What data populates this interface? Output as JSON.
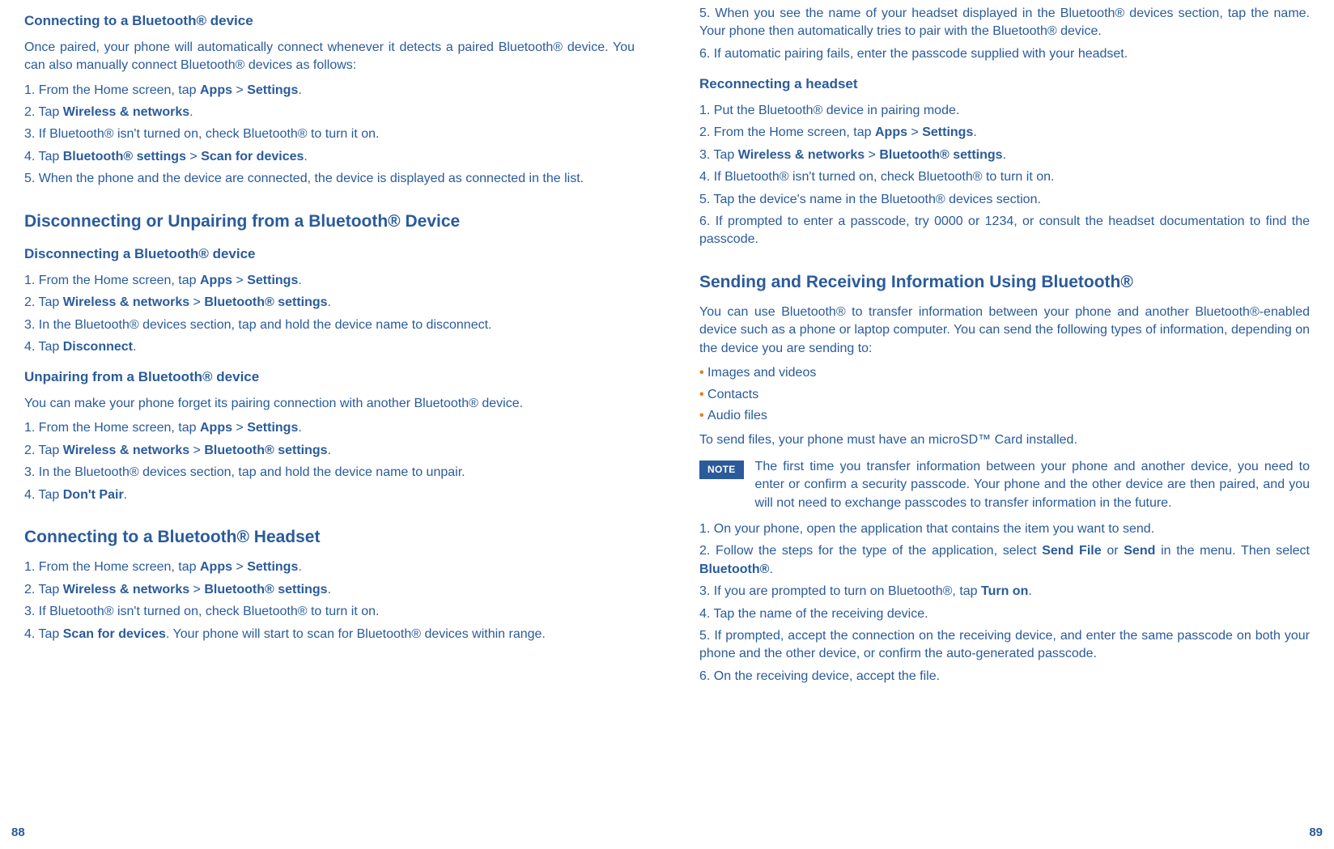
{
  "left": {
    "s1": {
      "title": "Connecting to a Bluetooth® device",
      "intro": "Once paired, your phone will automatically connect whenever it detects a paired Bluetooth® device. You can also manually connect Bluetooth® devices as follows:",
      "step1_a": "1. From the Home screen, tap ",
      "apps": "Apps",
      "gt": " > ",
      "settings": "Settings",
      "dot": ".",
      "step2_a": "2. Tap ",
      "step2_b": "Wireless & networks",
      "step3": "3. If Bluetooth® isn't turned on, check Bluetooth® to turn it on.",
      "step4_a": "4. Tap ",
      "step4_b": "Bluetooth® settings",
      "step4_c": " > ",
      "step4_d": "Scan for devices",
      "step5": "5. When the phone and the device are connected, the device is displayed as connected in the list."
    },
    "s2": {
      "title": "Disconnecting or Unpairing from a Bluetooth® Device",
      "sub1": "Disconnecting a Bluetooth® device",
      "d_step1_a": "1. From the Home screen, tap ",
      "d_step2_a": "2. Tap ",
      "d_step2_b": "Wireless & networks",
      "d_step2_c": " > ",
      "d_step2_d": "Bluetooth® settings",
      "d_step3": "3. In the Bluetooth® devices section, tap and hold the device name to disconnect.",
      "d_step4_a": "4. Tap ",
      "d_step4_b": "Disconnect",
      "sub2": "Unpairing from a Bluetooth® device",
      "u_intro": "You can make your phone forget its pairing connection with another Bluetooth® device.",
      "u_step3": "3. In the Bluetooth® devices section, tap and hold the device name to unpair.",
      "u_step4_a": "4. Tap ",
      "u_step4_b": "Don't Pair"
    },
    "s3": {
      "title": "Connecting to a Bluetooth® Headset",
      "h_step3": "3. If Bluetooth® isn't turned on, check Bluetooth® to turn it on.",
      "h_step4_a": "4. Tap ",
      "h_step4_b": "Scan for devices",
      "h_step4_c": ". Your phone will start to scan for Bluetooth® devices within range."
    },
    "page_num": "88"
  },
  "right": {
    "cont": {
      "step5": "5. When you see the name of your headset displayed in the Bluetooth® devices section, tap the name. Your phone then automatically tries to pair with the Bluetooth® device.",
      "step6": "6. If automatic pairing fails, enter the passcode supplied with your headset."
    },
    "s4": {
      "title": "Reconnecting a headset",
      "r_step1": "1. Put the Bluetooth® device in pairing mode.",
      "r_step2_a": "2. From the Home screen, tap ",
      "r_step3_a": "3. Tap ",
      "r_step4": "4. If Bluetooth® isn't turned on, check Bluetooth® to turn it on.",
      "r_step5": "5. Tap the device's name in the Bluetooth® devices section.",
      "r_step6": "6. If prompted to enter a passcode, try 0000 or 1234, or consult the headset documentation to find the passcode."
    },
    "s5": {
      "title": "Sending and Receiving Information Using Bluetooth®",
      "intro": "You can use Bluetooth® to transfer information between your phone and another Bluetooth®-enabled device such as a phone or laptop computer. You can send the following types of information, depending on the device you are sending to:",
      "b1": "Images and videos",
      "b2": "Contacts",
      "b3": "Audio files",
      "line": "To send files, your phone must have an microSD™ Card installed.",
      "note_label": "NOTE",
      "note_text": "The first time you transfer information between your phone and another device, you need to enter or confirm a security passcode. Your phone and the other device are then paired, and you will not need to exchange passcodes to transfer information in the future.",
      "s_step1": "1. On your phone, open the application that contains the item you want to send.",
      "s_step2_a": "2. Follow the steps for the type of the application, select ",
      "s_step2_b": "Send File",
      "s_step2_c": " or ",
      "s_step2_d": "Send",
      "s_step2_e": " in the menu. Then select ",
      "s_step2_f": "Bluetooth®",
      "s_step3_a": "3. If you are prompted to turn on Bluetooth®, tap ",
      "s_step3_b": "Turn on",
      "s_step4": "4. Tap the name of the receiving device.",
      "s_step5": "5. If prompted, accept the connection on the receiving device, and enter the same passcode on both your phone and the other device, or confirm the auto-generated passcode.",
      "s_step6": "6. On the receiving device, accept the file."
    },
    "page_num": "89"
  }
}
